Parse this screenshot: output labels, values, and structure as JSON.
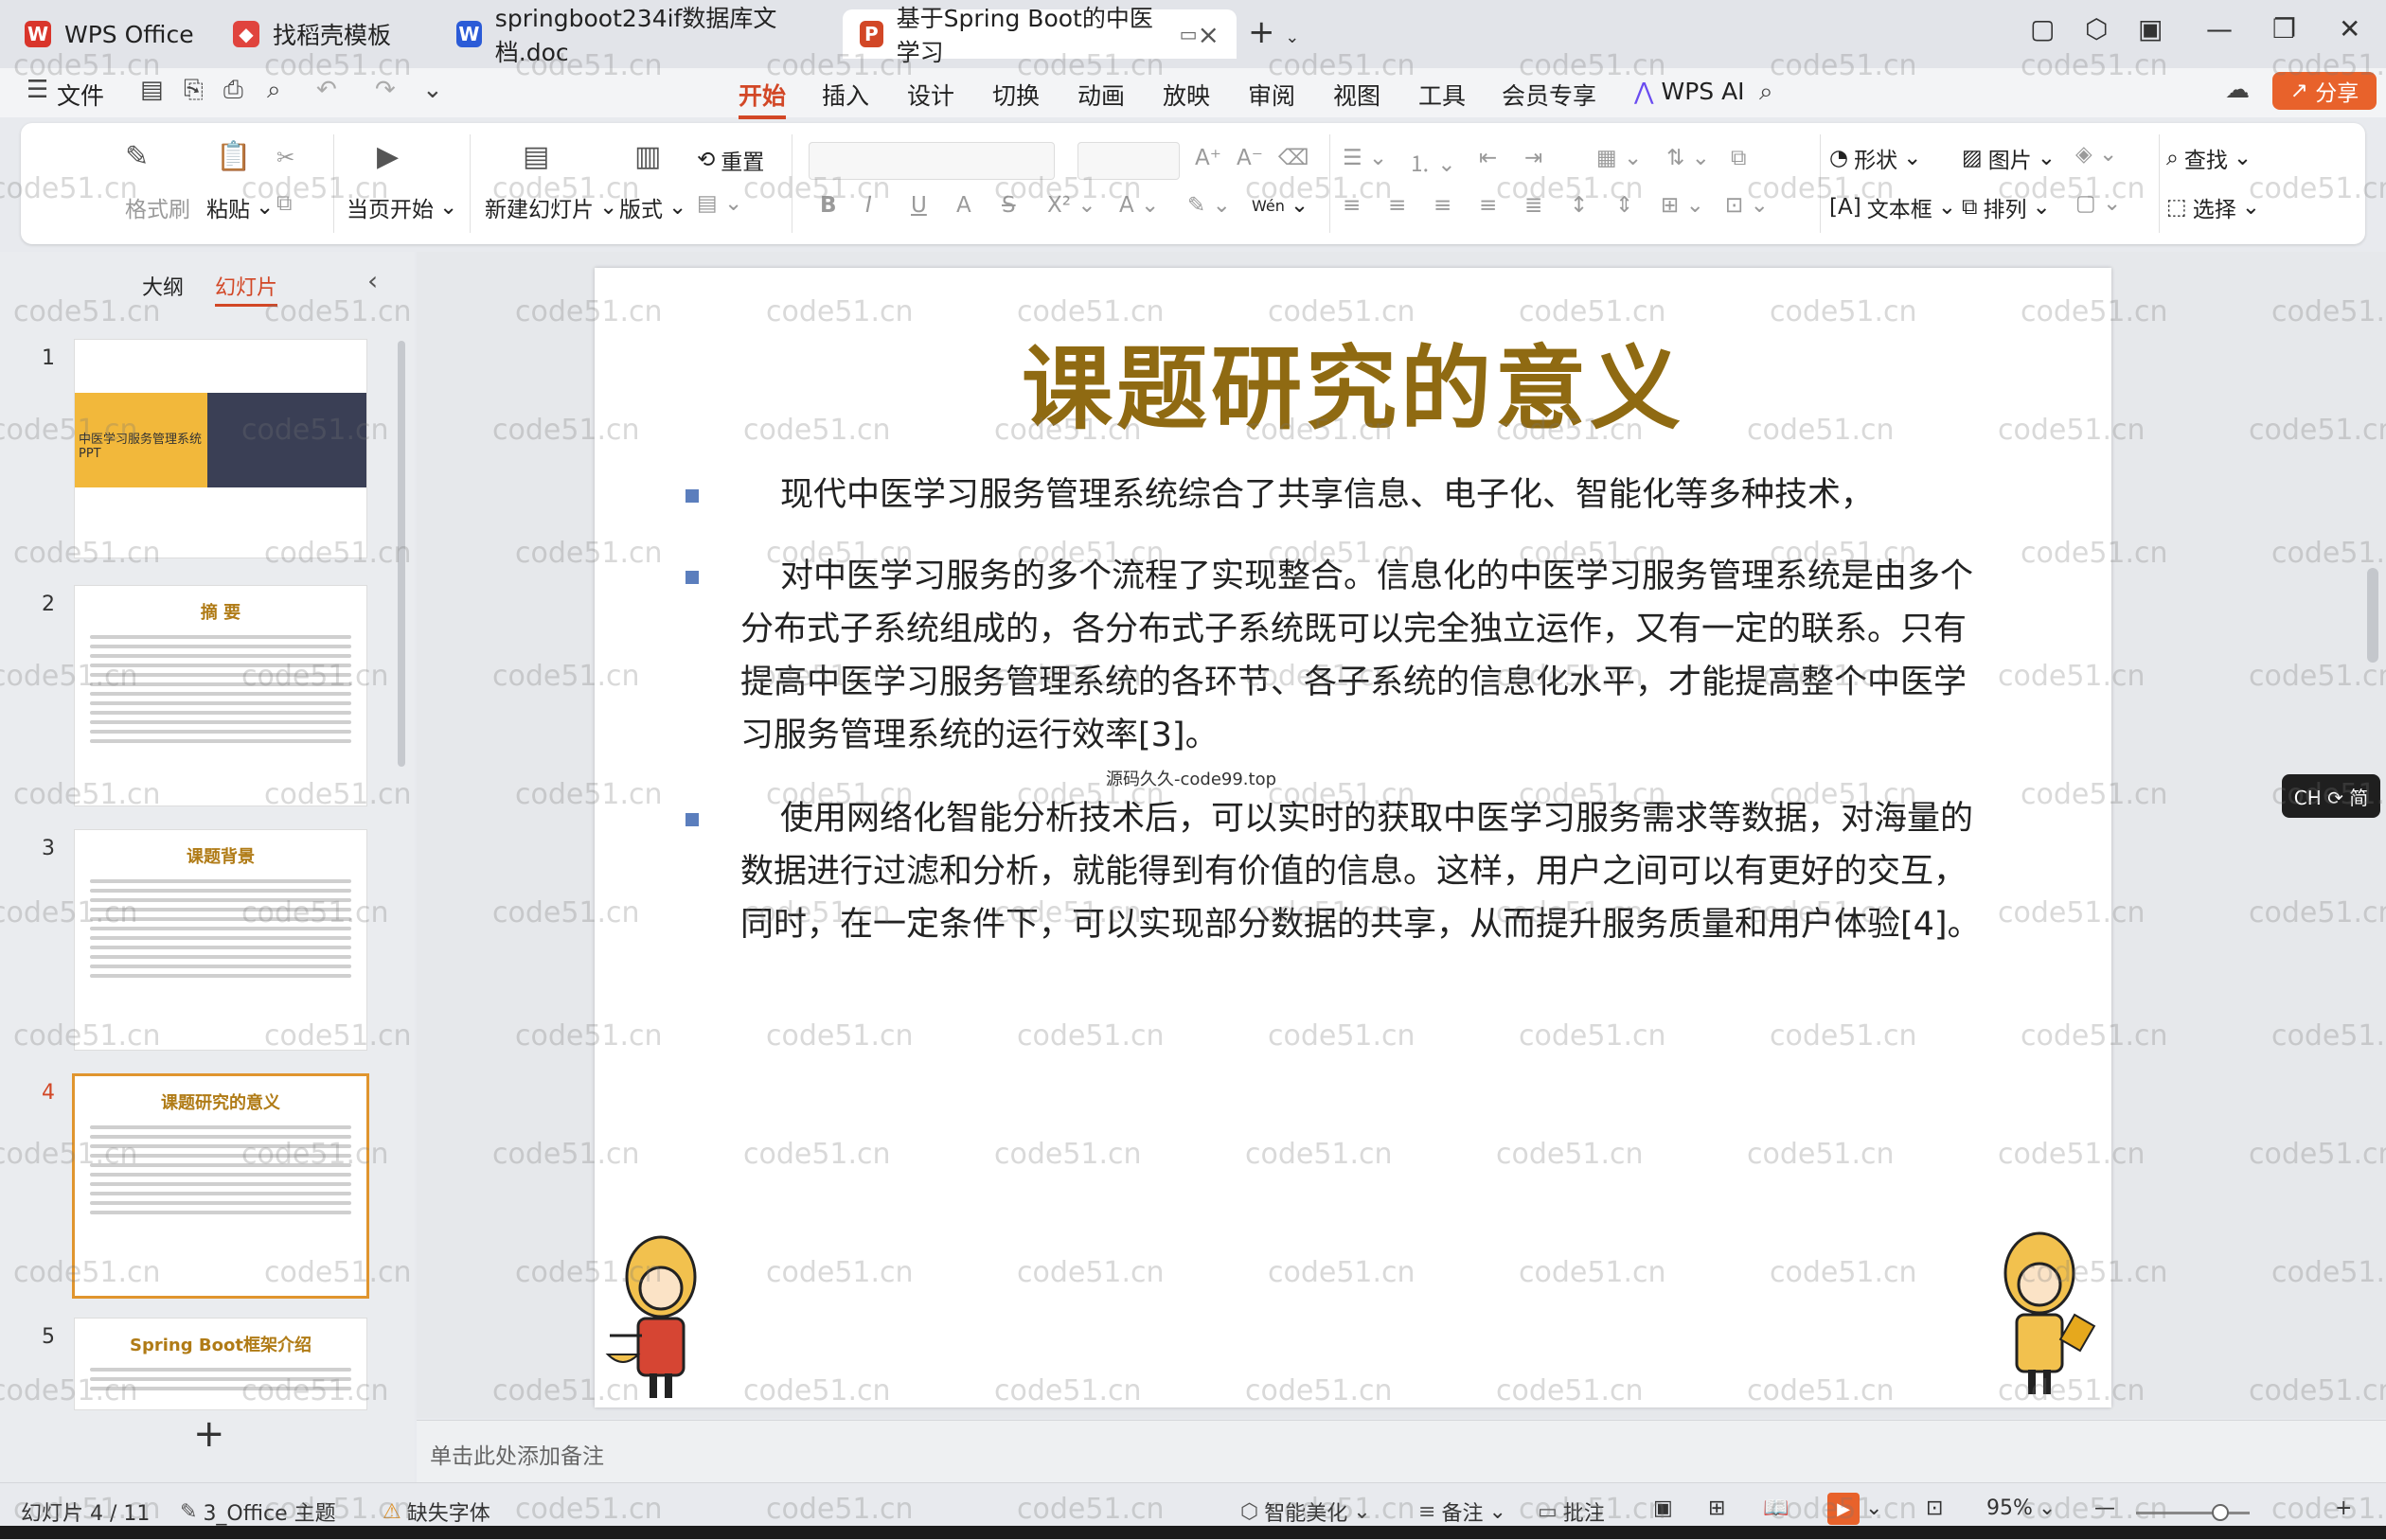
{
  "tabs": [
    {
      "label": "WPS Office",
      "icon": "wps-logo-icon",
      "color": "#d9352b"
    },
    {
      "label": "找稻壳模板",
      "icon": "docer-icon",
      "color": "#e0443e"
    },
    {
      "label": "springboot234if数据库文档.doc",
      "icon": "word-doc-icon",
      "color": "#2b5bd7"
    },
    {
      "label": "基于Spring Boot的中医学习",
      "icon": "ppt-icon",
      "color": "#d24726"
    }
  ],
  "menu": {
    "file": "文件",
    "items": [
      "开始",
      "插入",
      "设计",
      "切换",
      "动画",
      "放映",
      "审阅",
      "视图",
      "工具",
      "会员专享"
    ],
    "active": "开始",
    "wps_ai": "WPS AI",
    "share": "分享"
  },
  "ribbon": {
    "format_painter": "格式刷",
    "paste": "粘贴",
    "play_from_current": "当页开始",
    "new_slide": "新建幻灯片",
    "layout": "版式",
    "reset": "重置",
    "text_change_icon": "Wén",
    "shape": "形状",
    "picture": "图片",
    "textbox": "文本框",
    "arrange": "排列",
    "find": "查找",
    "select": "选择"
  },
  "left_panel": {
    "tabs": [
      "大纲",
      "幻灯片"
    ],
    "active_tab": "幻灯片",
    "thumbnails": [
      {
        "num": "1",
        "title": "中医学习服务管理系统 PPT"
      },
      {
        "num": "2",
        "title": "摘  要"
      },
      {
        "num": "3",
        "title": "课题背景"
      },
      {
        "num": "4",
        "title": "课题研究的意义"
      },
      {
        "num": "5",
        "title": "Spring Boot框架介绍"
      }
    ],
    "active_slide": "4",
    "add_slide": "+"
  },
  "slide": {
    "title": "课题研究的意义",
    "paragraphs": [
      "现代中医学习服务管理系统综合了共享信息、电子化、智能化等多种技术，",
      "对中医学习服务的多个流程了实现整合。信息化的中医学习服务管理系统是由多个分布式子系统组成的，各分布式子系统既可以完全独立运作，又有一定的联系。只有提高中医学习服务管理系统的各环节、各子系统的信息化水平，才能提高整个中医学习服务管理系统的运行效率[3]。",
      "使用网络化智能分析技术后，可以实时的获取中医学习服务需求等数据，对海量的数据进行过滤和分析，就能得到有价值的信息。这样，用户之间可以有更好的交互，同时，在一定条件下，可以实现部分数据的共享，从而提升服务质量和用户体验[4]。"
    ],
    "inline_watermark": "源码久久-code99.top",
    "title_color": "#8f6a12"
  },
  "watermark_text": "code51.cn",
  "notes_placeholder": "单击此处添加备注",
  "ime": "CH ⟳ 简",
  "status": {
    "slide_counter": "幻灯片 4 / 11",
    "theme": "3_Office 主题",
    "missing_font": "缺失字体",
    "beautify": "智能美化",
    "notes": "备注",
    "comments": "批注",
    "zoom": "95%"
  }
}
